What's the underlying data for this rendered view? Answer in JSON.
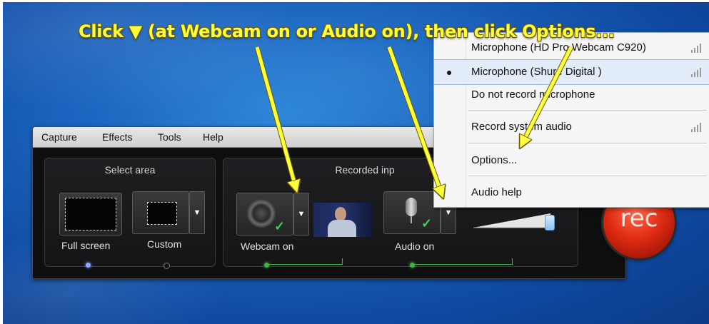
{
  "annotation": {
    "text": "Click ▼ (at Webcam on or Audio on), then click Options..."
  },
  "menubar": {
    "items": [
      "Capture",
      "Effects",
      "Tools",
      "Help"
    ]
  },
  "select_area": {
    "title": "Select area",
    "full_screen_label": "Full screen",
    "custom_label": "Custom"
  },
  "recorded_inputs": {
    "title": "Recorded inp",
    "webcam_label": "Webcam on",
    "audio_label": "Audio on"
  },
  "rec_button": {
    "label": "rec"
  },
  "audio_menu": {
    "items": [
      {
        "label": "Microphone (HD Pro Webcam C920)",
        "selected": false
      },
      {
        "label": "Microphone (Shure Digital    )",
        "selected": true
      },
      {
        "label": "Do not record microphone",
        "selected": false
      },
      {
        "label": "Record system audio",
        "selected": false
      },
      {
        "label": "Options...",
        "selected": false
      },
      {
        "label": "Audio help",
        "selected": false
      }
    ]
  },
  "colors": {
    "annotation": "#ffff3c",
    "accent_green": "#41b24a",
    "rec_red": "#e02b13",
    "selected_row": "#e1ecf8"
  }
}
